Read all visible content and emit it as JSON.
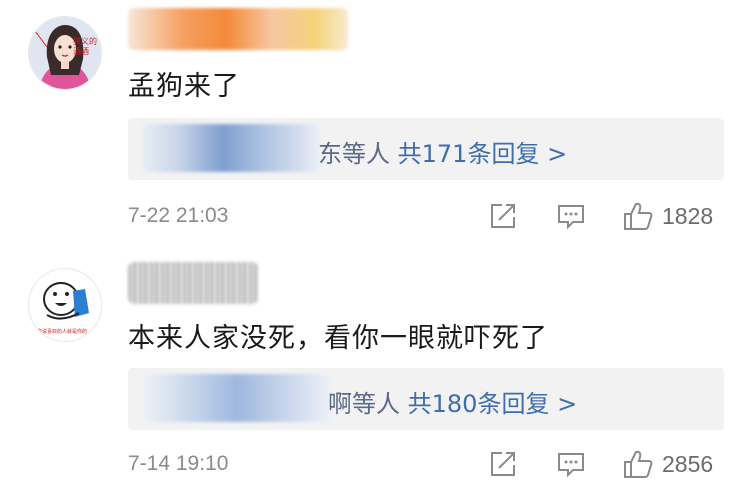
{
  "comments": [
    {
      "text": "孟狗来了",
      "avatar_caption": "狭义的 酒酒",
      "reply_name_tail": "东等人",
      "reply_link": "共171条回复 >",
      "time": "7-22 21:03",
      "likes": "1828"
    },
    {
      "text": "本来人家没死，看你一眼就吓死了",
      "reply_name_tail": "啊等人",
      "reply_link": "共180条回复 >",
      "time": "7-14 19:10",
      "likes": "2856"
    }
  ],
  "icons": [
    "share-icon",
    "comment-icon",
    "like-icon"
  ],
  "colors": {
    "link": "#3e6dad",
    "meta": "#8a8a8a",
    "reply_bg": "#f2f2f2"
  }
}
